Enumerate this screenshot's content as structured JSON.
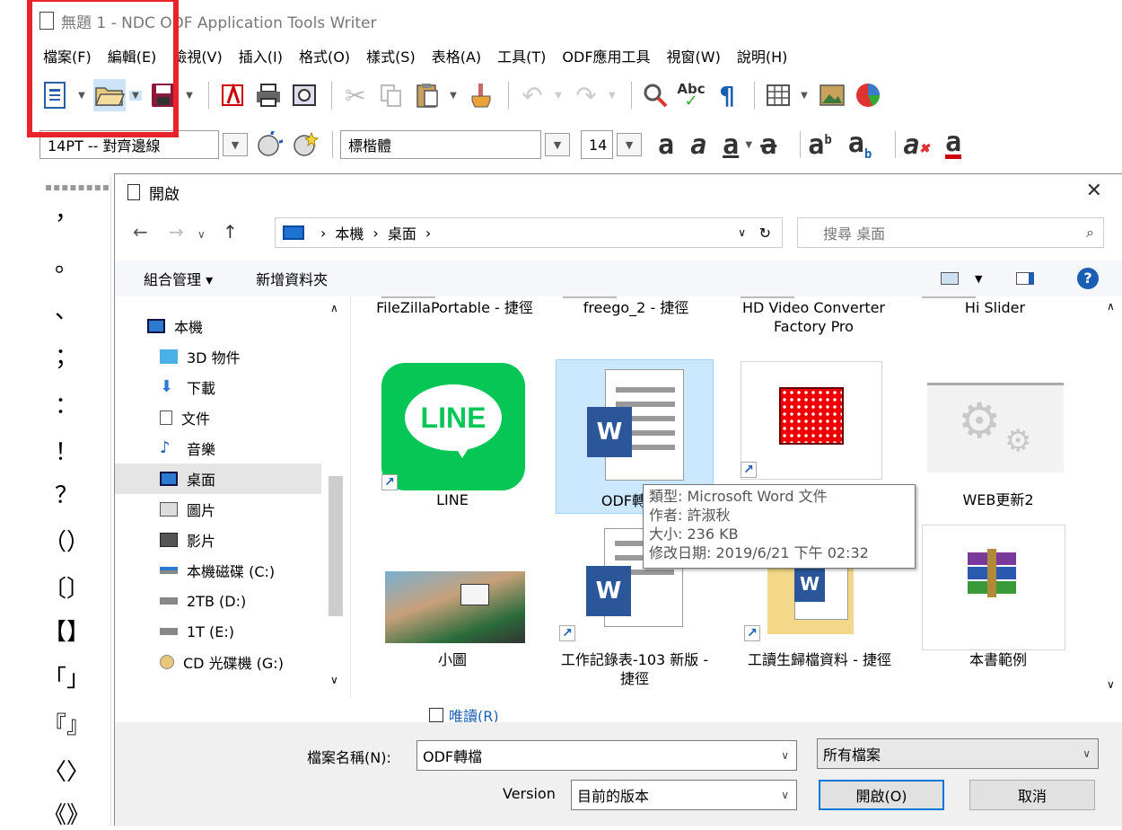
{
  "window": {
    "title": "無題 1 - NDC ODF Application Tools Writer"
  },
  "menu": [
    "檔案(F)",
    "編輯(E)",
    "檢視(V)",
    "插入(I)",
    "格式(O)",
    "樣式(S)",
    "表格(A)",
    "工具(T)",
    "ODF應用工具",
    "視窗(W)",
    "說明(H)"
  ],
  "format_bar": {
    "paragraph_style": "14PT -- 對齊邊線",
    "font_name": "標楷體",
    "font_size": "14"
  },
  "punctuation": [
    "，",
    "。",
    "、",
    "；",
    "：",
    "！",
    "？",
    "（）",
    "〔〕",
    "【】",
    "「」",
    "『』",
    "〈〉",
    "《》"
  ],
  "dialog": {
    "title": "開啟",
    "path": [
      "本機",
      "桌面"
    ],
    "search_placeholder": "搜尋 桌面",
    "organize": "組合管理 ▾",
    "new_folder": "新增資料夾",
    "nav_items": [
      {
        "label": "本機",
        "icon": "computer-icon"
      },
      {
        "label": "3D 物件",
        "icon": "cube-icon"
      },
      {
        "label": "下載",
        "icon": "download-icon"
      },
      {
        "label": "文件",
        "icon": "document-icon"
      },
      {
        "label": "音樂",
        "icon": "music-icon"
      },
      {
        "label": "桌面",
        "icon": "desktop-icon"
      },
      {
        "label": "圖片",
        "icon": "picture-icon"
      },
      {
        "label": "影片",
        "icon": "video-icon"
      },
      {
        "label": "本機磁碟 (C:)",
        "icon": "drive-icon"
      },
      {
        "label": "2TB (D:)",
        "icon": "drive-icon"
      },
      {
        "label": "1T (E:)",
        "icon": "drive-icon"
      },
      {
        "label": "CD 光碟機 (G:)",
        "icon": "cd-icon"
      }
    ],
    "files_row0": [
      "FileZillaPortable - 捷徑",
      "freego_2 - 捷徑",
      "HD Video Converter Factory Pro",
      "Hi Slider"
    ],
    "files": [
      {
        "name": "LINE"
      },
      {
        "name": "ODF轉"
      },
      {
        "name": ""
      },
      {
        "name": "WEB更新2"
      },
      {
        "name": "小圖"
      },
      {
        "name": "工作記錄表-103 新版 - 捷徑"
      },
      {
        "name": "工讀生歸檔資料 - 捷徑"
      },
      {
        "name": "本書範例"
      }
    ],
    "tooltip": [
      "類型: Microsoft Word 文件",
      "作者: 許淑秋",
      "大小: 236 KB",
      "修改日期: 2019/6/21 下午 02:32"
    ],
    "read_only": "唯讀(R)",
    "filename_label": "檔案名稱(N):",
    "filename_value": "ODF轉檔",
    "filter": "所有檔案",
    "version_label": "Version",
    "version_value": "目前的版本",
    "open_button": "開啟(O)",
    "cancel_button": "取消"
  }
}
